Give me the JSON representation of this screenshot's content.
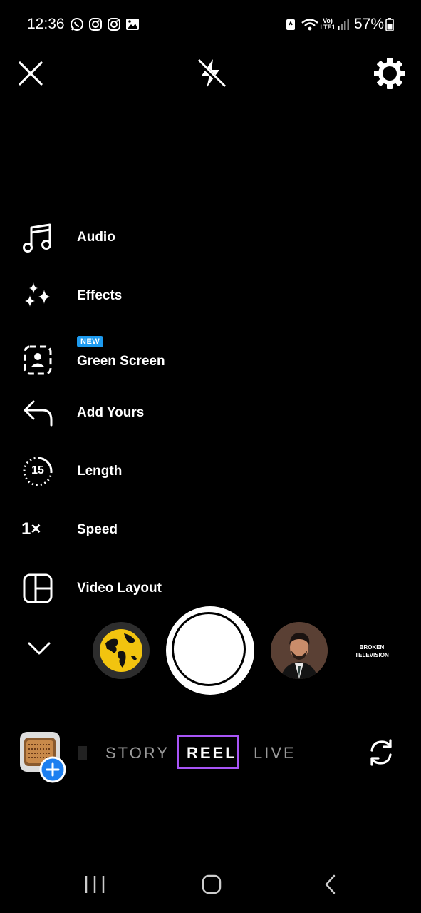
{
  "status_bar": {
    "time": "12:36",
    "battery": "57%",
    "network": "Vo) LTE1"
  },
  "menu": {
    "items": [
      {
        "label": "Audio"
      },
      {
        "label": "Effects"
      },
      {
        "label": "Green Screen",
        "badge": "NEW"
      },
      {
        "label": "Add Yours"
      },
      {
        "label": "Length",
        "icon_text": "15"
      },
      {
        "label": "Speed",
        "icon_text": "1×"
      },
      {
        "label": "Video Layout"
      }
    ]
  },
  "thumbnails": {
    "broken_tv_text": "BROKEN TELEVISION"
  },
  "modes": {
    "story": "STORY",
    "reel": "REEL",
    "live": "LIVE",
    "selected": "REEL"
  },
  "colors": {
    "background": "#000000",
    "accent_badge": "#1d9bf0",
    "selected_outline": "#a855f7",
    "globe": "#f2c40f"
  }
}
